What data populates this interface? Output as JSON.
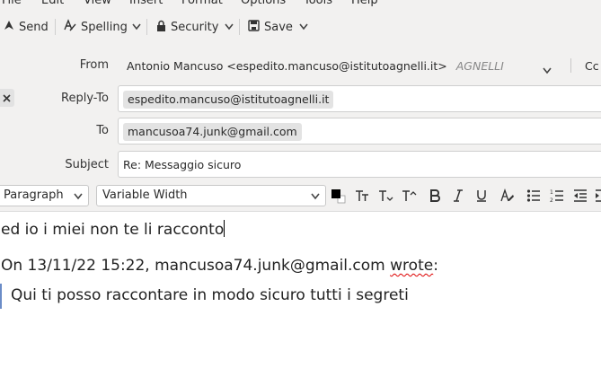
{
  "menubar": {
    "items": [
      "File",
      "Edit",
      "View",
      "Insert",
      "Format",
      "Options",
      "Tools",
      "Help"
    ]
  },
  "toolbar": {
    "send_label": "Send",
    "spelling_label": "Spelling",
    "security_label": "Security",
    "save_label": "Save"
  },
  "headers": {
    "from_label": "From",
    "from_value": "Antonio Mancuso <espedito.mancuso@istitutoagnelli.it>",
    "from_account": "AGNELLI",
    "cc_label": "Cc",
    "replyto_label": "Reply-To",
    "replyto_value": "espedito.mancuso@istitutoagnelli.it",
    "to_label": "To",
    "to_value": "mancusoa74.junk@gmail.com",
    "subject_label": "Subject",
    "subject_value": "Re: Messaggio sicuro"
  },
  "format": {
    "paragraph_label": "Paragraph",
    "font_label": "Variable Width"
  },
  "body": {
    "line1": "ed io i miei non te li racconto",
    "attribution_prefix": "On 13/11/22 15:22, mancusoa74.junk@gmail.com ",
    "attribution_word": "wrote",
    "attribution_suffix": ":",
    "quoted": "Qui ti posso raccontare in modo sicuro tutti i segreti"
  },
  "colors": {
    "chrome": "#f2f1f0",
    "quote_bar": "#6b8cc7",
    "spell_error": "#dd0000"
  }
}
